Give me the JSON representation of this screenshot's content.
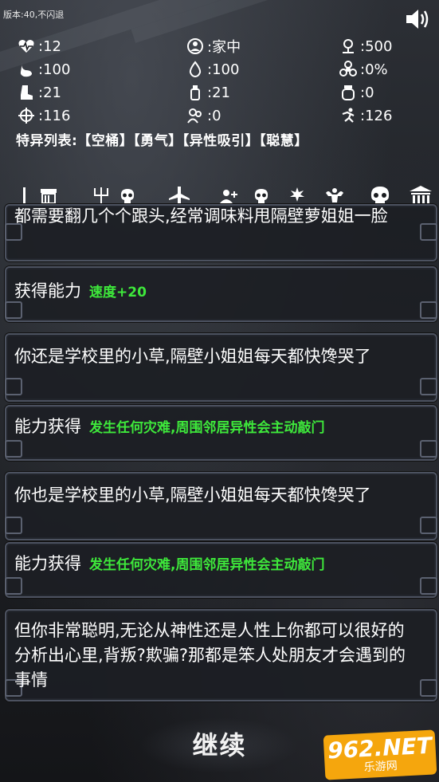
{
  "header": {
    "version": "版本:40,不闪退"
  },
  "stats": [
    {
      "icon": "heart-pulse-icon",
      "value": ":12"
    },
    {
      "icon": "globe-person-icon",
      "value": ":家中"
    },
    {
      "icon": "location-pin-icon",
      "value": ":500"
    },
    {
      "icon": "stomach-icon",
      "value": ":100"
    },
    {
      "icon": "water-drop-icon",
      "value": ":100"
    },
    {
      "icon": "biohazard-icon",
      "value": ":0%"
    },
    {
      "icon": "boot-icon",
      "value": ":21"
    },
    {
      "icon": "bottle-icon",
      "value": ":21"
    },
    {
      "icon": "jar-icon",
      "value": ":0"
    },
    {
      "icon": "crosshair-icon",
      "value": ":116"
    },
    {
      "icon": "group-icon",
      "value": ":0"
    },
    {
      "icon": "runner-icon",
      "value": ":126"
    }
  ],
  "traits": "特异列表:【空桶】【勇气】【异性吸引】【聪慧】",
  "tabs": [
    "shop-icon",
    "trident-icon",
    "skull-icon",
    "airplane-icon",
    "add-user-icon",
    "skull-icon",
    "hand-power-icon",
    "strongman-icon",
    "skull-icon",
    "bank-icon"
  ],
  "events": [
    {
      "text": "都需要翻几个个跟头,经常调味料甩隔壁萝姐姐一脸"
    },
    {
      "label": "获得能力",
      "value": "速度+20"
    },
    {
      "text": "你还是学校里的小草,隔壁小姐姐每天都快馋哭了"
    },
    {
      "label": "能力获得",
      "value": "发生任何灾难,周围邻居异性会主动敲门"
    },
    {
      "text": "你也是学校里的小草,隔壁小姐姐每天都快馋哭了"
    },
    {
      "label": "能力获得",
      "value": "发生任何灾难,周围邻居异性会主动敲门"
    },
    {
      "text": "但你非常聪明,无论从神性还是人性上你都可以很好的分析出心里,背叛?欺骗?那都是笨人处朋友才会遇到的事情"
    }
  ],
  "continue_label": "继续",
  "watermark": {
    "main": "962.NET",
    "sub": "乐游网"
  },
  "colors": {
    "accent_green": "#3ee83b",
    "card_border": "#4c5260"
  }
}
